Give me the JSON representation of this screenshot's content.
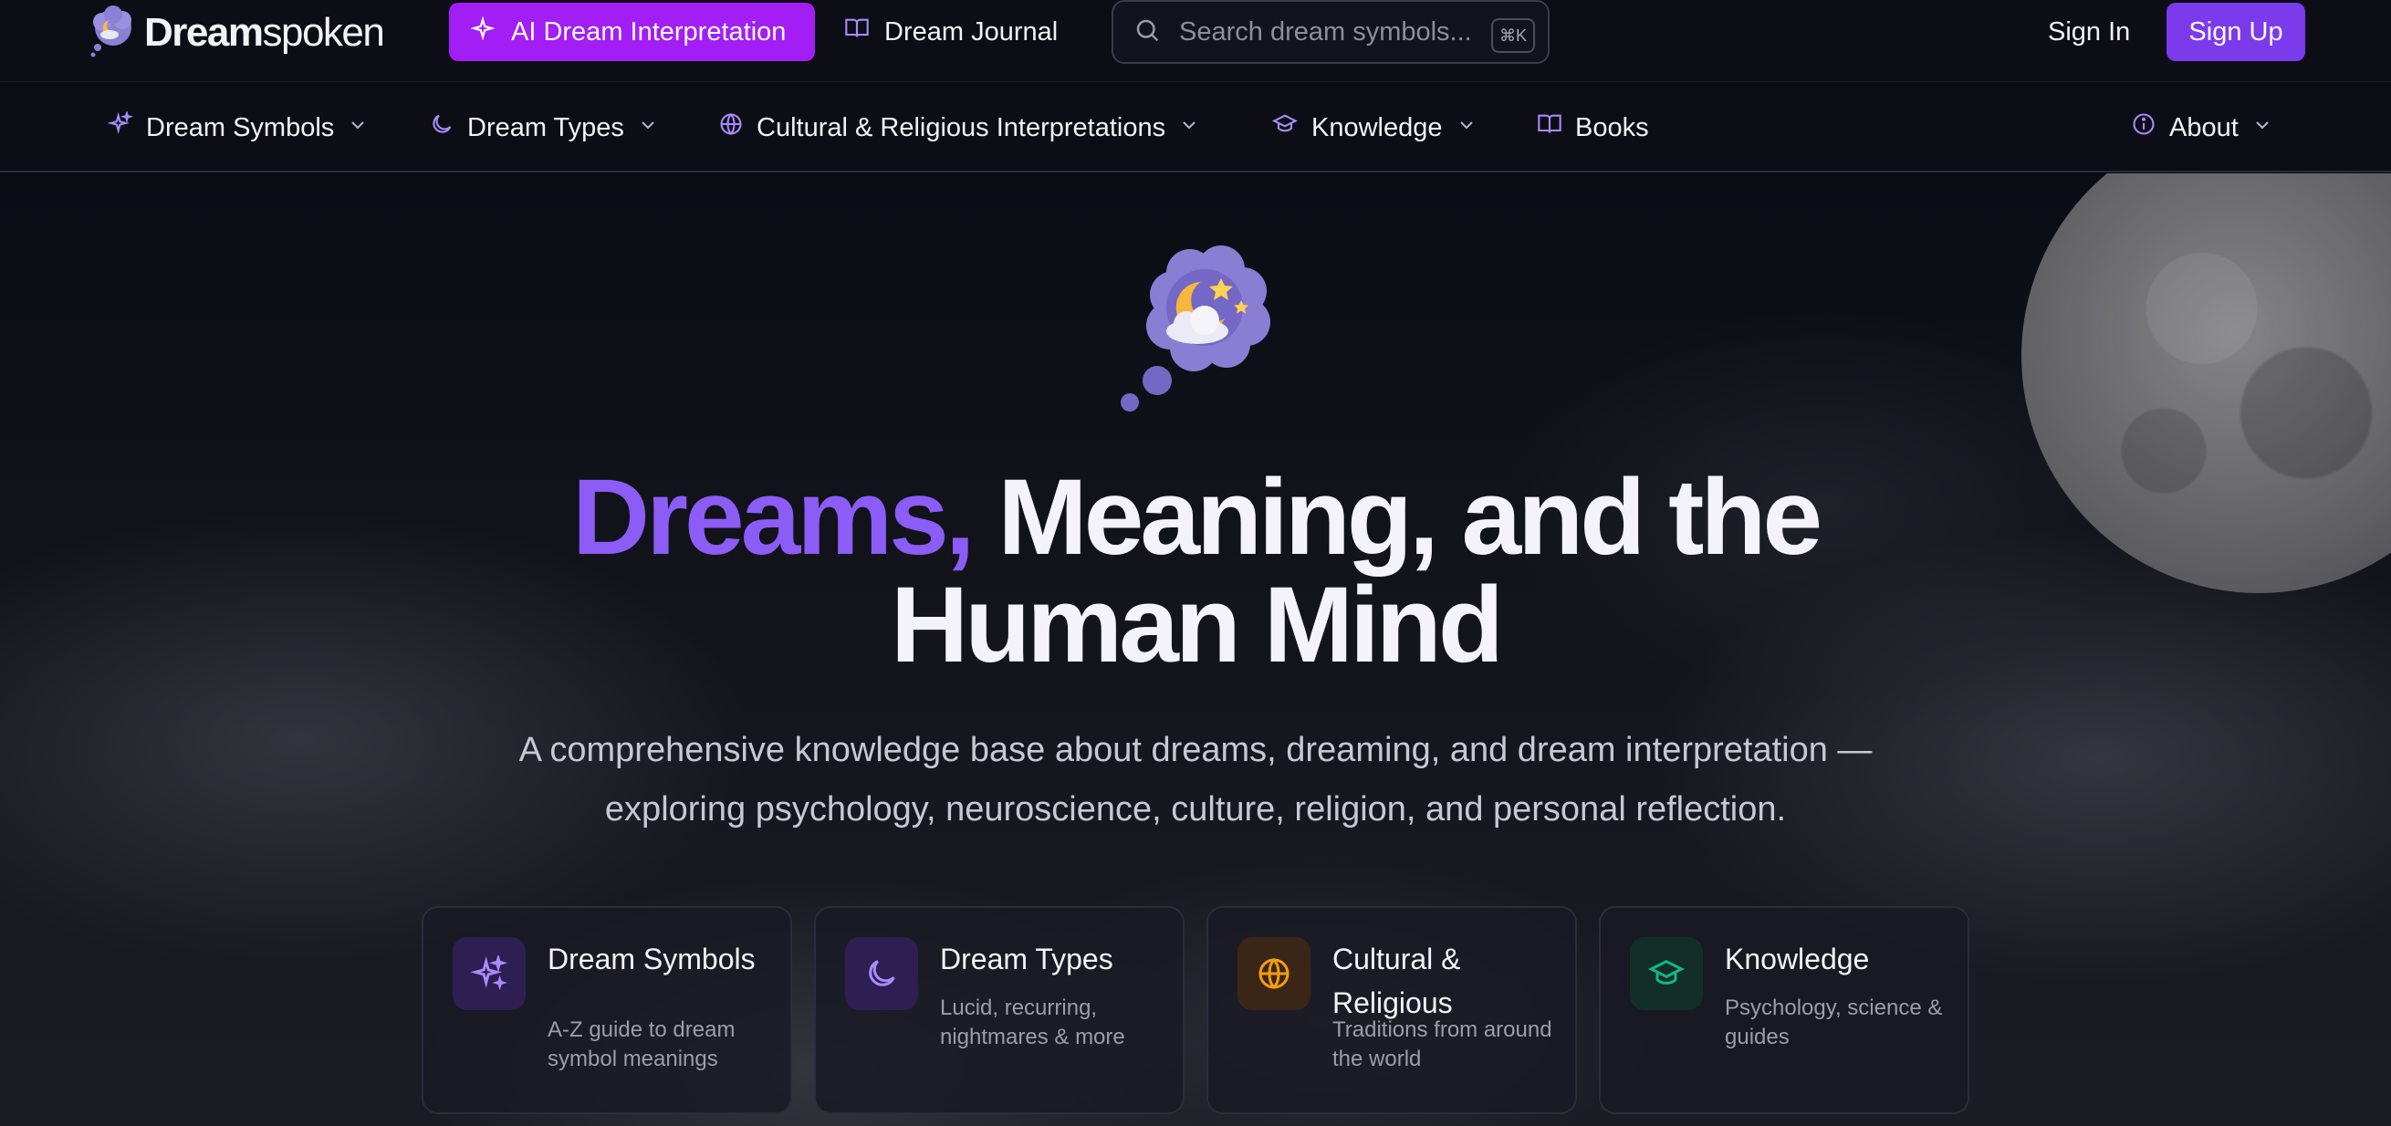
{
  "brand": {
    "name_bold": "Dream",
    "name_light": "spoken"
  },
  "topbar": {
    "ai_button_label": "AI Dream Interpretation",
    "journal_label": "Dream Journal",
    "search_placeholder": "Search dream symbols...",
    "search_shortcut": "⌘K",
    "signin_label": "Sign In",
    "signup_label": "Sign Up"
  },
  "nav": {
    "items": [
      {
        "label": "Dream Symbols",
        "icon": "sparkles-icon"
      },
      {
        "label": "Dream Types",
        "icon": "moon-icon"
      },
      {
        "label": "Cultural & Religious Interpretations",
        "icon": "globe-icon"
      },
      {
        "label": "Knowledge",
        "icon": "graduation-cap-icon"
      },
      {
        "label": "Books",
        "icon": "book-icon"
      }
    ],
    "about_label": "About"
  },
  "hero": {
    "title_accent": "Dreams,",
    "title_rest_1": "Meaning, and the",
    "title_rest_2": "Human Mind",
    "subtitle_1": "A comprehensive knowledge base about dreams, dreaming, and dream interpretation —",
    "subtitle_2": "exploring psychology, neuroscience, culture, religion, and personal reflection."
  },
  "cards": [
    {
      "title": "Dream Symbols",
      "desc": "A-Z guide to dream symbol meanings",
      "icon": "sparkles-icon",
      "color": "#a78bfa"
    },
    {
      "title": "Dream Types",
      "desc": "Lucid, recurring, nightmares & more",
      "icon": "moon-icon",
      "color": "#a78bfa"
    },
    {
      "title": "Cultural & Religious",
      "desc": "Traditions from around the world",
      "icon": "globe-icon",
      "color": "#f59e0b"
    },
    {
      "title": "Knowledge",
      "desc": "Psychology, science & guides",
      "icon": "graduation-cap-icon",
      "color": "#10b981"
    }
  ],
  "colors": {
    "accent": "#8b5cf6",
    "ai_button": "#a21ef5",
    "signup": "#7c3aed",
    "background": "#0c0c14"
  }
}
